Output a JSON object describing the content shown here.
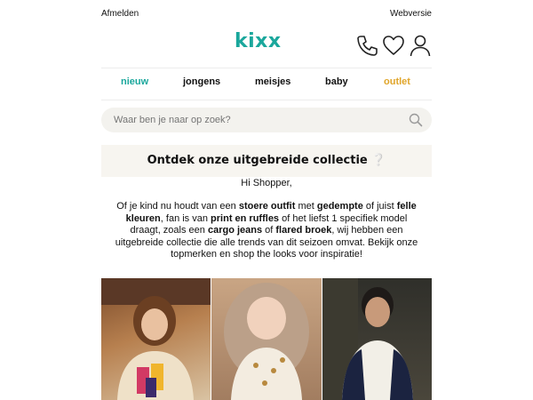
{
  "topbar": {
    "left": "Afmelden",
    "right": "Webversie"
  },
  "brand": {
    "logo": "kixx",
    "accent": "#1aa79c"
  },
  "header_icons": [
    "phone-icon",
    "heart-icon",
    "user-icon"
  ],
  "nav": {
    "items": [
      {
        "label": "nieuw",
        "color": "#1aa79c"
      },
      {
        "label": "jongens",
        "color": "#111111"
      },
      {
        "label": "meisjes",
        "color": "#111111"
      },
      {
        "label": "baby",
        "color": "#111111"
      },
      {
        "label": "outlet",
        "color": "#e0a52a"
      }
    ]
  },
  "search": {
    "placeholder": "Waar ben je naar op zoek?"
  },
  "banner": {
    "title": "Ontdek onze uitgebreide collectie ❔"
  },
  "greeting": "Hi Shopper,",
  "body": {
    "t1": "Of je kind nu houdt van een ",
    "b1": "stoere outfit",
    "t2": " met ",
    "b2": "gedempte",
    "t3": " of juist ",
    "b3": "felle kleuren",
    "t4": ", fan is van ",
    "b4": "print en ruffles",
    "t5": " of het liefst 1 specifiek model draagt, zoals een ",
    "b5": "cargo jeans",
    "t6": " of ",
    "b6": "flared broek",
    "t7": ", wij hebben een uitgebreide collectie die alle trends van dit seizoen omvat. Bekijk onze topmerken en shop the looks voor inspiratie!"
  }
}
